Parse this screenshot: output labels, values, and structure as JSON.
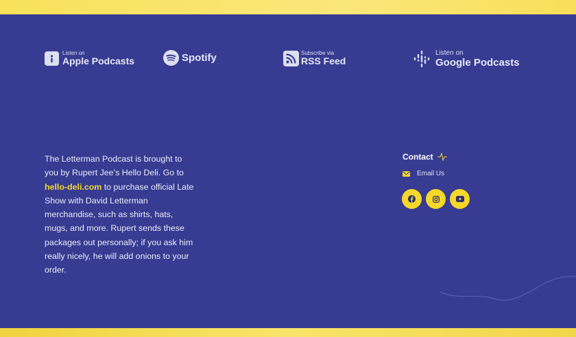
{
  "platforms": {
    "apple": {
      "small": "Listen on",
      "big": "Apple Podcasts"
    },
    "spotify": {
      "big": "Spotify"
    },
    "rss": {
      "small": "Subscribe via",
      "big": "RSS Feed"
    },
    "google": {
      "small": "Listen on",
      "big": "Google Podcasts"
    }
  },
  "about": {
    "text_before": "The Letterman Podcast is brought to you by Rupert Jee’s Hello Deli. Go to ",
    "link": "hello-deli.com",
    "text_after": " to purchase official Late Show with David Letterman merchandise, such as shirts, hats, mugs, and more. Rupert sends these packages out personally; if you ask him really nicely, he will add onions to your order."
  },
  "contact": {
    "title": "Contact",
    "email_label": "Email Us"
  },
  "colors": {
    "background": "#383b92",
    "accent": "#f5d829",
    "top_bar": "#f7e15a"
  },
  "icons": [
    "apple-podcasts-icon",
    "spotify-icon",
    "rss-icon",
    "google-podcasts-icon",
    "pulse-icon",
    "envelope-icon",
    "facebook-icon",
    "instagram-icon",
    "youtube-icon"
  ]
}
